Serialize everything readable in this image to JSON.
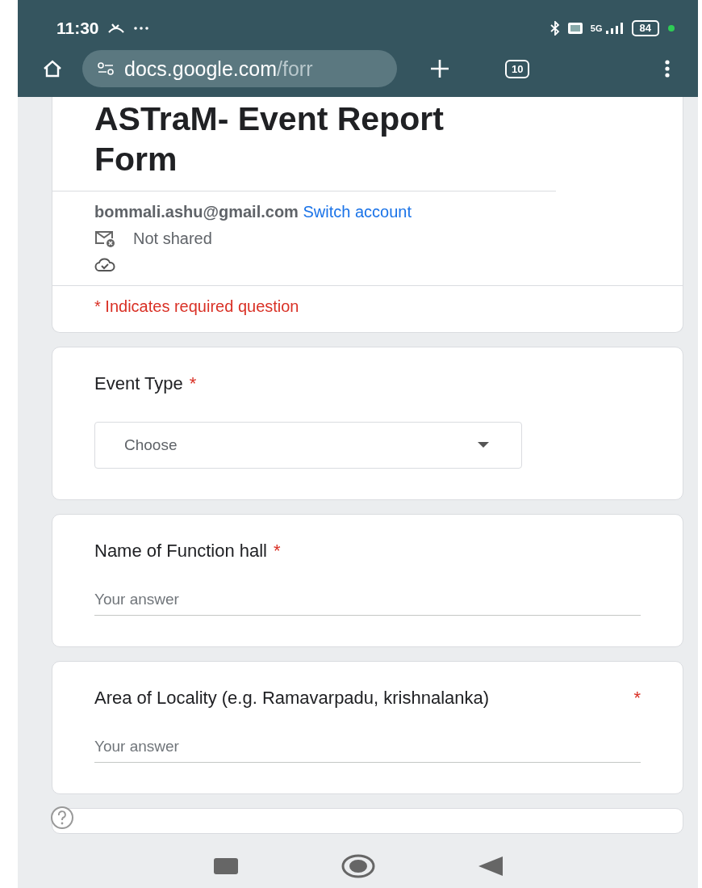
{
  "status_bar": {
    "time": "11:30",
    "battery": "84",
    "network": "5G"
  },
  "browser": {
    "url_host": "docs.google.com",
    "url_path": "/forr",
    "tab_count": "10"
  },
  "form": {
    "title": "ASTraM- Event Report Form",
    "email": "bommali.ashu@gmail.com",
    "switch_account": "Switch account",
    "sharing": "Not shared",
    "required_note": "* Indicates required question"
  },
  "questions": [
    {
      "kind": "dropdown",
      "label": "Event Type",
      "required_mark": "*",
      "placeholder": "Choose"
    },
    {
      "kind": "text",
      "label": "Name of Function hall",
      "required_mark": "*",
      "placeholder": "Your answer"
    },
    {
      "kind": "text",
      "label": "Area of Locality (e.g. Ramavarpadu, krishnalanka)",
      "required_mark": "*",
      "placeholder": "Your answer"
    }
  ]
}
